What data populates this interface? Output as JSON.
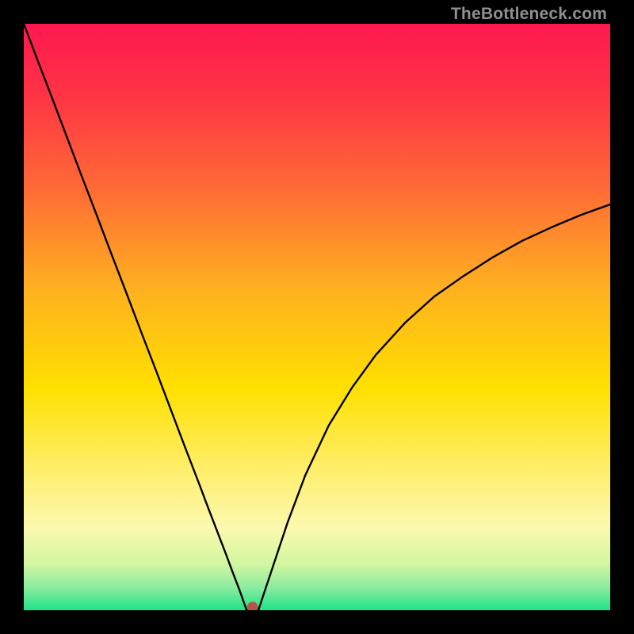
{
  "watermark": "TheBottleneck.com",
  "chart_data": {
    "type": "line",
    "title": "",
    "xlabel": "",
    "ylabel": "",
    "xlim": [
      0,
      100
    ],
    "ylim": [
      0,
      100
    ],
    "background_gradient": {
      "stops": [
        {
          "pos": 0.0,
          "color": "#ff1850"
        },
        {
          "pos": 0.12,
          "color": "#ff3345"
        },
        {
          "pos": 0.28,
          "color": "#ff6a36"
        },
        {
          "pos": 0.45,
          "color": "#ffb020"
        },
        {
          "pos": 0.62,
          "color": "#ffe000"
        },
        {
          "pos": 0.78,
          "color": "#fff07a"
        },
        {
          "pos": 0.86,
          "color": "#fbf9b0"
        },
        {
          "pos": 0.92,
          "color": "#d4f6a0"
        },
        {
          "pos": 0.96,
          "color": "#8eeda0"
        },
        {
          "pos": 1.0,
          "color": "#1fe28a"
        }
      ]
    },
    "series": [
      {
        "name": "bottleneck-curve",
        "color": "#000000",
        "x": [
          0.0,
          2.5,
          5.0,
          7.5,
          10.0,
          12.5,
          15.0,
          17.5,
          20.0,
          22.5,
          25.0,
          27.5,
          30.0,
          31.5,
          33.0,
          34.5,
          35.5,
          36.8,
          38.0,
          40.0,
          42.0,
          45.0,
          48.0,
          52.0,
          56.0,
          60.0,
          65.0,
          70.0,
          75.0,
          80.0,
          85.0,
          90.0,
          95.0,
          100.0
        ],
        "y": [
          100.0,
          93.4,
          86.9,
          80.3,
          73.7,
          67.2,
          60.6,
          54.1,
          47.5,
          41.0,
          34.4,
          27.8,
          21.3,
          17.3,
          13.4,
          9.5,
          6.8,
          3.4,
          0.0,
          0.0,
          6.0,
          15.0,
          23.0,
          31.5,
          38.0,
          43.5,
          49.0,
          53.5,
          57.0,
          60.2,
          63.0,
          65.3,
          67.4,
          69.2
        ]
      }
    ],
    "marker": {
      "name": "optimal-point",
      "x": 39.0,
      "y": 0.5,
      "color": "#b2564d",
      "radius_px": 7
    },
    "flat_bottom": {
      "x_start": 36.8,
      "x_end": 41.0
    }
  }
}
